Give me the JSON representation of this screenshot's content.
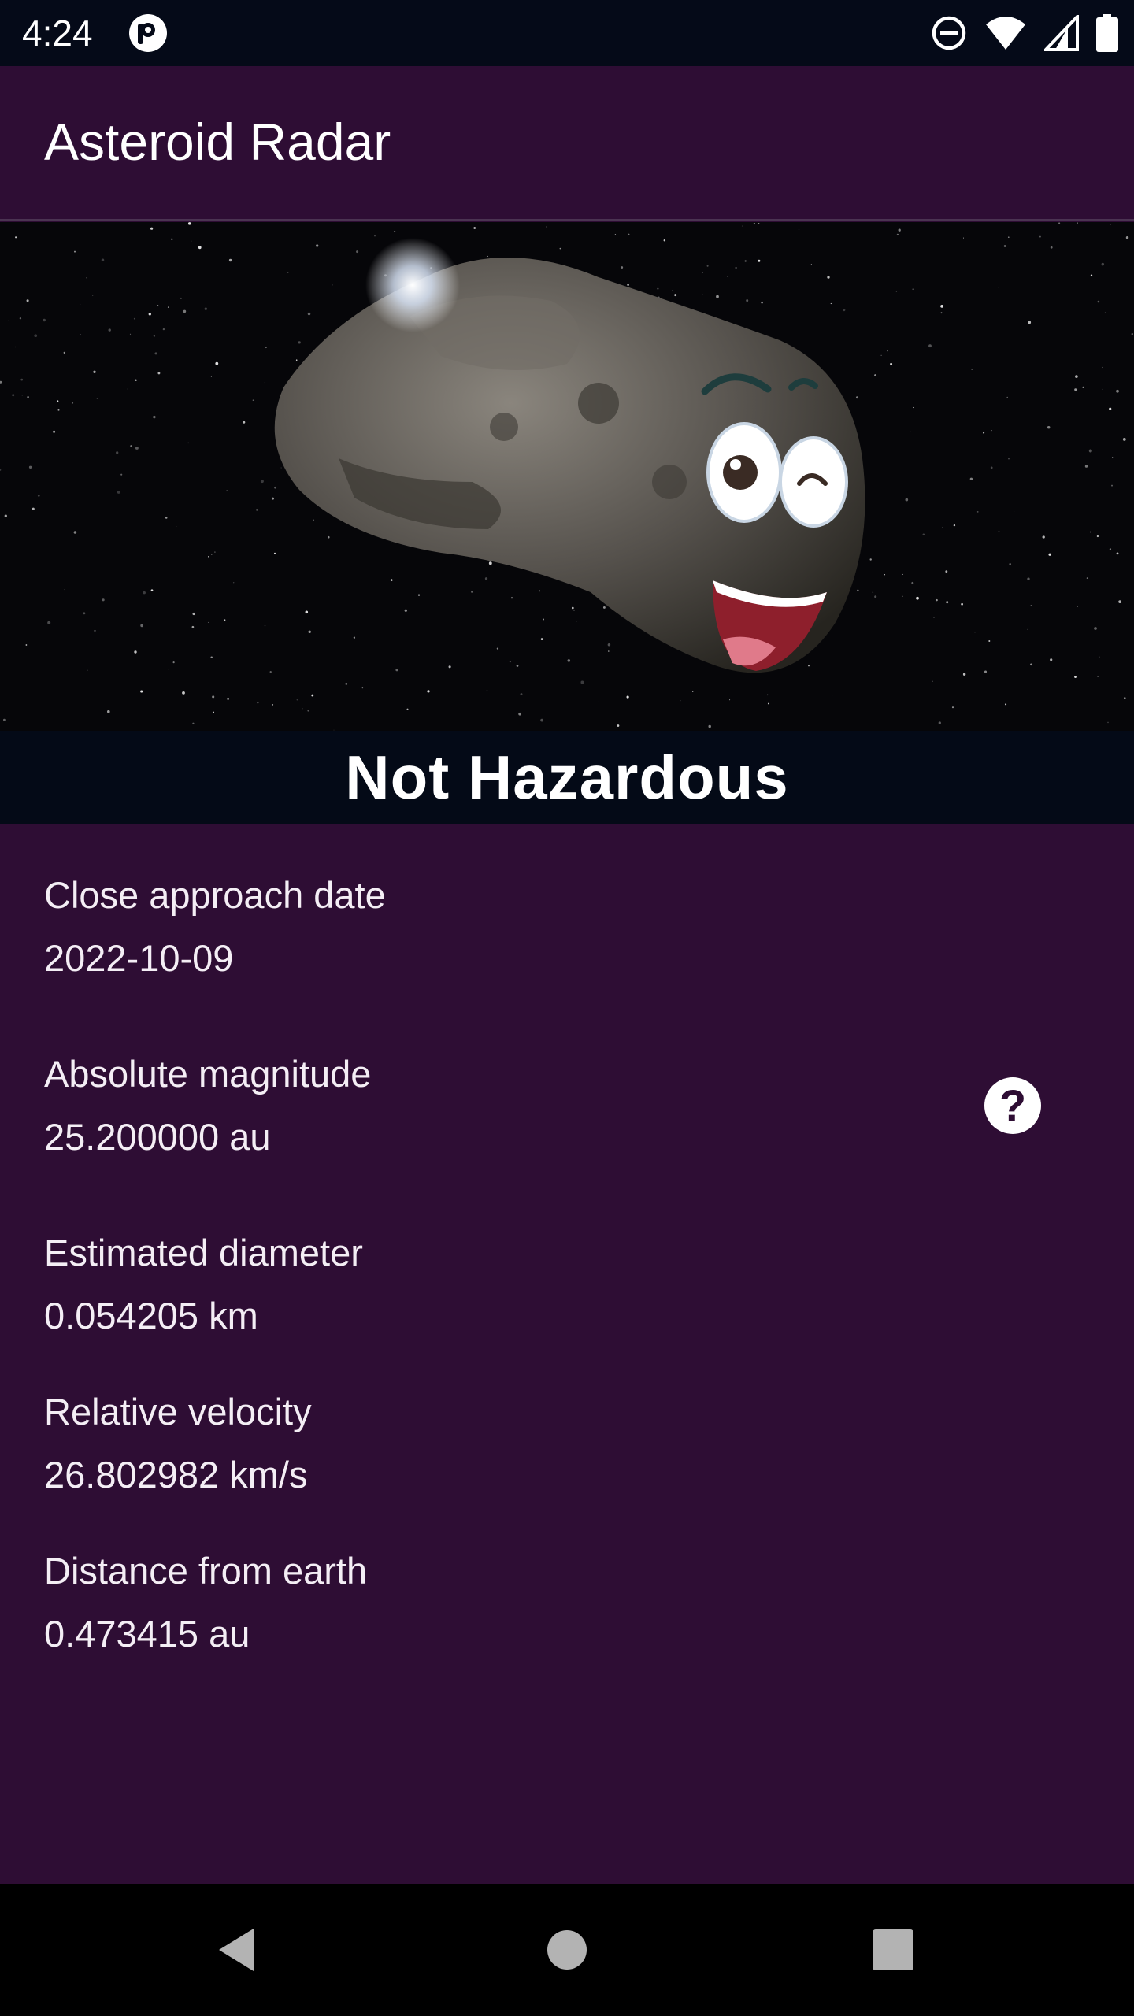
{
  "status_bar": {
    "time": "4:24",
    "icons": [
      "app-notification-icon",
      "do-not-disturb-icon",
      "wifi-icon",
      "cell-signal-icon",
      "battery-icon"
    ]
  },
  "app_bar": {
    "title": "Asteroid Radar"
  },
  "hero": {
    "image": "smiling-asteroid-illustration",
    "status_text": "Not Hazardous"
  },
  "details": {
    "close_approach_date": {
      "label": "Close approach date",
      "value": "2022-10-09"
    },
    "absolute_magnitude": {
      "label": "Absolute magnitude",
      "value": "25.200000 au"
    },
    "estimated_diameter": {
      "label": "Estimated diameter",
      "value": "0.054205 km"
    },
    "relative_velocity": {
      "label": "Relative velocity",
      "value": "26.802982 km/s"
    },
    "distance_from_earth": {
      "label": "Distance from earth",
      "value": "0.473415 au"
    },
    "help_icon": "question-mark-icon"
  },
  "nav_bar": {
    "buttons": [
      "back-icon",
      "home-icon",
      "recents-icon"
    ]
  },
  "colors": {
    "background": "#2e0d34",
    "status_bar": "#050a18",
    "banner": "#040a17",
    "text": "#ffffff"
  }
}
